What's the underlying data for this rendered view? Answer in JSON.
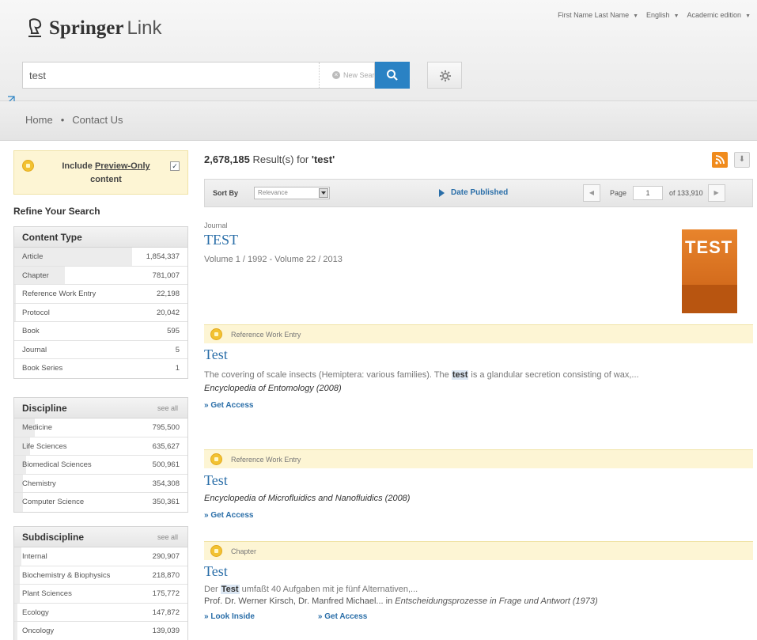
{
  "header": {
    "logo_main": "Springer",
    "logo_suffix": "Link",
    "user_name": "First Name Last Name",
    "language": "English",
    "edition": "Academic edition"
  },
  "search": {
    "query": "test",
    "new_search_label": "New Search"
  },
  "nav": {
    "home": "Home",
    "separator": "•",
    "contact": "Contact Us"
  },
  "sidebar": {
    "preview_prefix": "Include",
    "preview_link": "Preview-Only",
    "preview_suffix": "content",
    "preview_checked": true,
    "refine_title": "Refine Your Search",
    "see_all": "see all",
    "content_type": {
      "title": "Content Type",
      "items": [
        {
          "label": "Article",
          "count": "1,854,337",
          "share": 0.68
        },
        {
          "label": "Chapter",
          "count": "781,007",
          "share": 0.29
        },
        {
          "label": "Reference Work Entry",
          "count": "22,198",
          "share": 0.01
        },
        {
          "label": "Protocol",
          "count": "20,042",
          "share": 0.01
        },
        {
          "label": "Book",
          "count": "595",
          "share": 0
        },
        {
          "label": "Journal",
          "count": "5",
          "share": 0
        },
        {
          "label": "Book Series",
          "count": "1",
          "share": 0
        }
      ]
    },
    "discipline": {
      "title": "Discipline",
      "items": [
        {
          "label": "Medicine",
          "count": "795,500",
          "share": 0.12
        },
        {
          "label": "Life Sciences",
          "count": "635,627",
          "share": 0.09
        },
        {
          "label": "Biomedical Sciences",
          "count": "500,961",
          "share": 0.07
        },
        {
          "label": "Chemistry",
          "count": "354,308",
          "share": 0.05
        },
        {
          "label": "Computer Science",
          "count": "350,361",
          "share": 0.05
        }
      ]
    },
    "subdiscipline": {
      "title": "Subdiscipline",
      "items": [
        {
          "label": "Internal",
          "count": "290,907",
          "share": 0.04
        },
        {
          "label": "Biochemistry & Biophysics",
          "count": "218,870",
          "share": 0.03
        },
        {
          "label": "Plant Sciences",
          "count": "175,772",
          "share": 0.03
        },
        {
          "label": "Ecology",
          "count": "147,872",
          "share": 0.02
        },
        {
          "label": "Oncology",
          "count": "139,039",
          "share": 0.02
        }
      ]
    }
  },
  "results": {
    "count": "2,678,185",
    "label": "Result(s) for",
    "query_quoted": "'test'",
    "sort_by": "Sort By",
    "sort_value": "Relevance",
    "date_published": "Date Published",
    "page_label": "Page",
    "page_value": "1",
    "page_total": "of 133,910",
    "items": [
      {
        "type": "Journal",
        "title": "TEST",
        "meta": "Volume 1 / 1992 - Volume 22 / 2013",
        "cover_text": "TEST"
      },
      {
        "type": "Reference Work Entry",
        "title": "Test",
        "snippet_before": "The covering of scale insects (Hemiptera: various families). The ",
        "snippet_hl": "test",
        "snippet_after": " is a glandular secretion consisting of wax,...",
        "source": "Encyclopedia of Entomology (2008)",
        "link": "» Get Access"
      },
      {
        "type": "Reference Work Entry",
        "title": "Test",
        "source": "Encyclopedia of Microfluidics and Nanofluidics (2008)",
        "link": "» Get Access"
      },
      {
        "type": "Chapter",
        "title": "Test",
        "snippet_before": "Der ",
        "snippet_hl": "Test",
        "snippet_after": " umfaßt 40 Aufgaben mit je fünf Alternativen,...",
        "authors": "Prof. Dr. Werner Kirsch, Dr. Manfred Michael... in ",
        "source": "Entscheidungsprozesse in Frage und Antwort (1973)",
        "link_look": "» Look Inside",
        "link": "» Get Access"
      }
    ]
  },
  "colors": {
    "accent": "#2a82c4",
    "link": "#2a6ea8",
    "highlight_bg": "#fdf5d4",
    "rss": "#f08b1d"
  }
}
